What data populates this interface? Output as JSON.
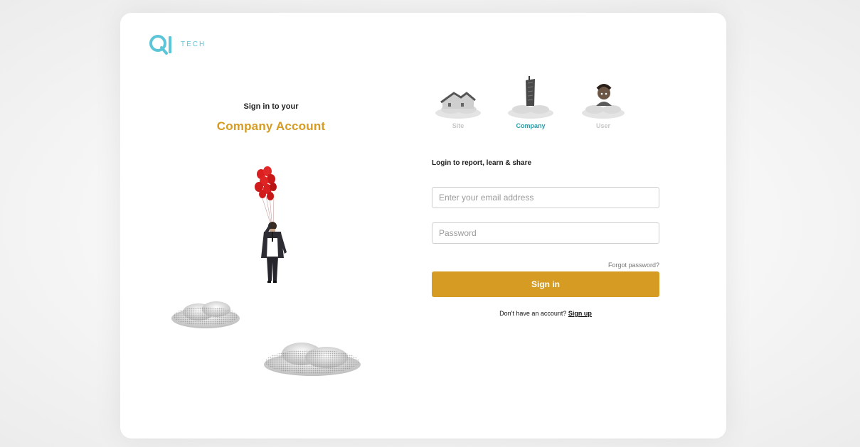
{
  "brand": {
    "logo_letters": "QI",
    "logo_text": "TECH",
    "color": "#5cc6d8"
  },
  "left": {
    "heading": "Sign in to your",
    "subheading": "Company Account",
    "accent_color": "#d69b22",
    "illustration": "businessman-with-red-balloons-and-clouds"
  },
  "account_types": [
    {
      "label": "Site",
      "icon": "house-on-cloud-icon",
      "active": false
    },
    {
      "label": "Company",
      "icon": "skyscraper-on-cloud-icon",
      "active": true
    },
    {
      "label": "User",
      "icon": "person-on-cloud-icon",
      "active": false
    }
  ],
  "form": {
    "tagline": "Login to report, learn & share",
    "email_placeholder": "Enter your email address",
    "email_value": "",
    "password_placeholder": "Password",
    "password_value": "",
    "forgot_label": "Forgot password?",
    "submit_label": "Sign in",
    "signup_prompt": "Don't have an account?",
    "signup_label": "Sign up",
    "button_color": "#d69b22",
    "active_color": "#2d9aa5"
  }
}
